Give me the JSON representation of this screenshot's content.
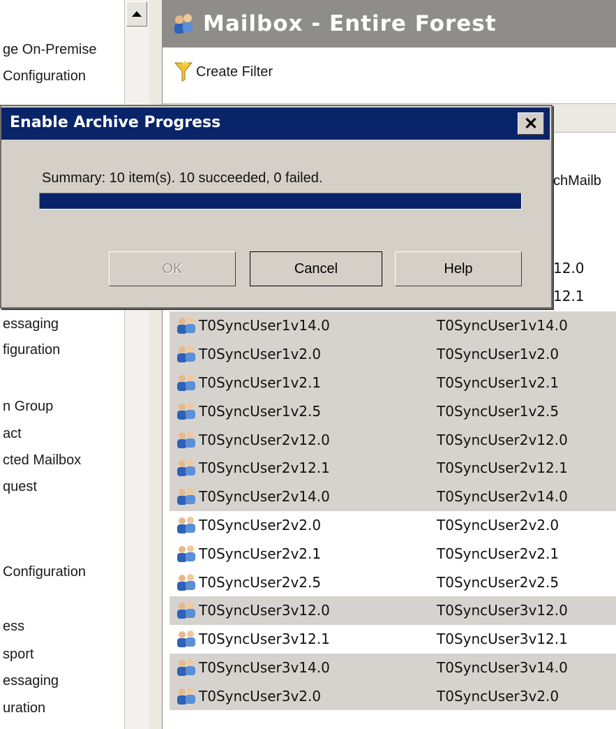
{
  "nav": {
    "items": [
      "ge On-Premise",
      "Configuration",
      "essaging",
      "figuration",
      "n Group",
      "act",
      "cted Mailbox",
      "quest",
      "Configuration",
      "ess",
      "sport",
      "essaging",
      "uration"
    ]
  },
  "pane": {
    "title": "Mailbox - Entire Forest",
    "create_filter": "Create Filter",
    "partial_col": "chMailb",
    "partial_v1": "12.0",
    "partial_v2": "12.1"
  },
  "rows": [
    {
      "name": "T0SyncUser1v14.0",
      "alias": "T0SyncUser1v14.0",
      "selected": true
    },
    {
      "name": "T0SyncUser1v2.0",
      "alias": "T0SyncUser1v2.0",
      "selected": true
    },
    {
      "name": "T0SyncUser1v2.1",
      "alias": "T0SyncUser1v2.1",
      "selected": true
    },
    {
      "name": "T0SyncUser1v2.5",
      "alias": "T0SyncUser1v2.5",
      "selected": true
    },
    {
      "name": "T0SyncUser2v12.0",
      "alias": "T0SyncUser2v12.0",
      "selected": true
    },
    {
      "name": "T0SyncUser2v12.1",
      "alias": "T0SyncUser2v12.1",
      "selected": true
    },
    {
      "name": "T0SyncUser2v14.0",
      "alias": "T0SyncUser2v14.0",
      "selected": true
    },
    {
      "name": "T0SyncUser2v2.0",
      "alias": "T0SyncUser2v2.0",
      "selected": false
    },
    {
      "name": "T0SyncUser2v2.1",
      "alias": "T0SyncUser2v2.1",
      "selected": false
    },
    {
      "name": "T0SyncUser2v2.5",
      "alias": "T0SyncUser2v2.5",
      "selected": false
    },
    {
      "name": "T0SyncUser3v12.0",
      "alias": "T0SyncUser3v12.0",
      "selected": true
    },
    {
      "name": "T0SyncUser3v12.1",
      "alias": "T0SyncUser3v12.1",
      "selected": false
    },
    {
      "name": "T0SyncUser3v14.0",
      "alias": "T0SyncUser3v14.0",
      "selected": true
    },
    {
      "name": "T0SyncUser3v2.0",
      "alias": "T0SyncUser3v2.0",
      "selected": true
    }
  ],
  "dialog": {
    "title": "Enable Archive Progress",
    "close_glyph": "✕",
    "summary": "Summary: 10 item(s). 10 succeeded, 0 failed.",
    "progress_percent": 100,
    "ok_label": "OK",
    "cancel_label": "Cancel",
    "help_label": "Help"
  },
  "colors": {
    "titlebar": "#0a246a",
    "selected_row": "#d6d3ce",
    "header": "#8e8d89"
  }
}
